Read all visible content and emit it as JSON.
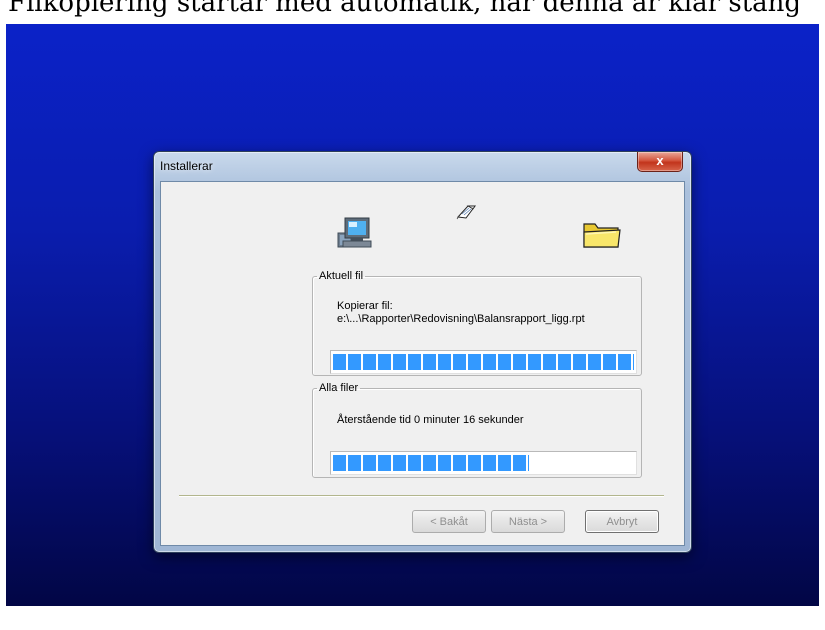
{
  "banner": {
    "text": "Filkopiering startar med automatik, när denna är klar stäng"
  },
  "window": {
    "title": "Installerar",
    "close_label": "x"
  },
  "icons": {
    "source": "computer-icon",
    "transfer": "flying-document-icon",
    "destination": "folder-icon"
  },
  "current_file": {
    "legend": "Aktuell fil",
    "action": "Kopierar fil:",
    "path": "e:\\...\\Rapporter\\Redovisning\\Balansrapport_ligg.rpt",
    "progress_fraction": 1.0
  },
  "all_files": {
    "legend": "Alla filer",
    "remaining": "Återstående tid 0 minuter 16 sekunder",
    "progress_fraction": 0.65
  },
  "buttons": {
    "back": "< Bakåt",
    "next": "Nästa >",
    "cancel": "Avbryt"
  },
  "colors": {
    "desktop_top": "#0b22c8",
    "desktop_bottom": "#020645",
    "progress_fill": "#3399ff",
    "close_button": "#c2341c"
  }
}
